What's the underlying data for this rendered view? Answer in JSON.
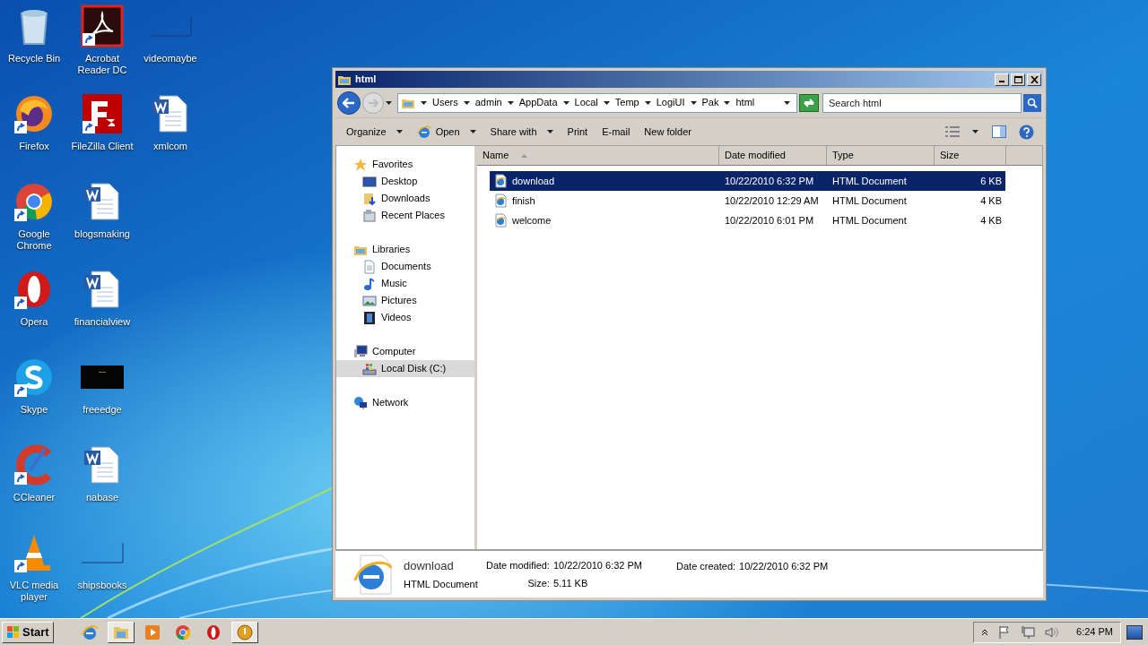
{
  "desktop": {
    "columns": [
      [
        {
          "label": "Recycle Bin",
          "kind": "recycle",
          "shortcut": false
        },
        {
          "label": "Firefox",
          "kind": "firefox",
          "shortcut": true
        },
        {
          "label": "Google Chrome",
          "kind": "chrome",
          "shortcut": true
        },
        {
          "label": "Opera",
          "kind": "opera",
          "shortcut": true
        },
        {
          "label": "Skype",
          "kind": "skype",
          "shortcut": true
        },
        {
          "label": "CCleaner",
          "kind": "ccleaner",
          "shortcut": true
        },
        {
          "label": "VLC media player",
          "kind": "vlc",
          "shortcut": true
        }
      ],
      [
        {
          "label": "Acrobat Reader DC",
          "kind": "acrobat",
          "shortcut": true
        },
        {
          "label": "FileZilla Client",
          "kind": "filezilla",
          "shortcut": true
        },
        {
          "label": "blogsmaking",
          "kind": "word",
          "shortcut": false
        },
        {
          "label": "financialview",
          "kind": "word",
          "shortcut": false
        },
        {
          "label": "freeedge",
          "kind": "dark",
          "shortcut": false
        },
        {
          "label": "nabase",
          "kind": "word",
          "shortcut": false
        },
        {
          "label": "shipsbooks",
          "kind": "blank",
          "shortcut": false
        }
      ],
      [
        {
          "label": "videomaybe",
          "kind": "blank",
          "shortcut": false
        },
        {
          "label": "xmlcom",
          "kind": "word",
          "shortcut": false
        }
      ]
    ]
  },
  "window": {
    "title": "html",
    "address": {
      "crumbs": [
        "Users",
        "admin",
        "AppData",
        "Local",
        "Temp",
        "LogiUI",
        "Pak",
        "html"
      ]
    },
    "search": {
      "placeholder": "Search html"
    },
    "toolbar": [
      {
        "label": "Organize",
        "dropdown": true,
        "icon": false
      },
      {
        "label": "Open",
        "dropdown": true,
        "icon": true
      },
      {
        "label": "Share with",
        "dropdown": true,
        "icon": false
      },
      {
        "label": "Print",
        "dropdown": false,
        "icon": false
      },
      {
        "label": "E-mail",
        "dropdown": false,
        "icon": false
      },
      {
        "label": "New folder",
        "dropdown": false,
        "icon": false
      }
    ],
    "nav": [
      {
        "label": "Favorites",
        "kind": "star",
        "selected": false,
        "children": [
          {
            "label": "Desktop",
            "kind": "desktop",
            "selected": false
          },
          {
            "label": "Downloads",
            "kind": "downloads",
            "selected": false
          },
          {
            "label": "Recent Places",
            "kind": "recent",
            "selected": false
          }
        ]
      },
      {
        "label": "Libraries",
        "kind": "library",
        "selected": false,
        "children": [
          {
            "label": "Documents",
            "kind": "document",
            "selected": false
          },
          {
            "label": "Music",
            "kind": "music",
            "selected": false
          },
          {
            "label": "Pictures",
            "kind": "pictures",
            "selected": false
          },
          {
            "label": "Videos",
            "kind": "videos",
            "selected": false
          }
        ]
      },
      {
        "label": "Computer",
        "kind": "computer",
        "selected": false,
        "children": [
          {
            "label": "Local Disk (C:)",
            "kind": "disk",
            "selected": true
          }
        ]
      },
      {
        "label": "Network",
        "kind": "network",
        "selected": false
      }
    ],
    "columns": [
      {
        "label": "Name",
        "sorted": true
      },
      {
        "label": "Date modified",
        "sorted": false
      },
      {
        "label": "Type",
        "sorted": false
      },
      {
        "label": "Size",
        "sorted": false
      }
    ],
    "files": [
      {
        "name": "download",
        "date": "10/22/2010 6:32 PM",
        "type": "HTML Document",
        "size": "6 KB",
        "selected": true
      },
      {
        "name": "finish",
        "date": "10/22/2010 12:29 AM",
        "type": "HTML Document",
        "size": "4 KB",
        "selected": false
      },
      {
        "name": "welcome",
        "date": "10/22/2010 6:01 PM",
        "type": "HTML Document",
        "size": "4 KB",
        "selected": false
      }
    ],
    "details": {
      "name": "download",
      "type": "HTML Document",
      "fields": [
        {
          "label": "Date modified:",
          "value": "10/22/2010 6:32 PM"
        },
        {
          "label": "Size:",
          "value": "5.11 KB"
        },
        {
          "label": "Date created:",
          "value": "10/22/2010 6:32 PM"
        }
      ]
    }
  },
  "taskbar": {
    "start": "Start",
    "apps": [
      {
        "kind": "ie",
        "active": false
      },
      {
        "kind": "explorer",
        "active": true
      },
      {
        "kind": "media",
        "active": false
      },
      {
        "kind": "chrome",
        "active": false
      },
      {
        "kind": "opera",
        "active": false
      },
      {
        "kind": "app",
        "active": true
      }
    ],
    "clock": "6:24 PM"
  }
}
